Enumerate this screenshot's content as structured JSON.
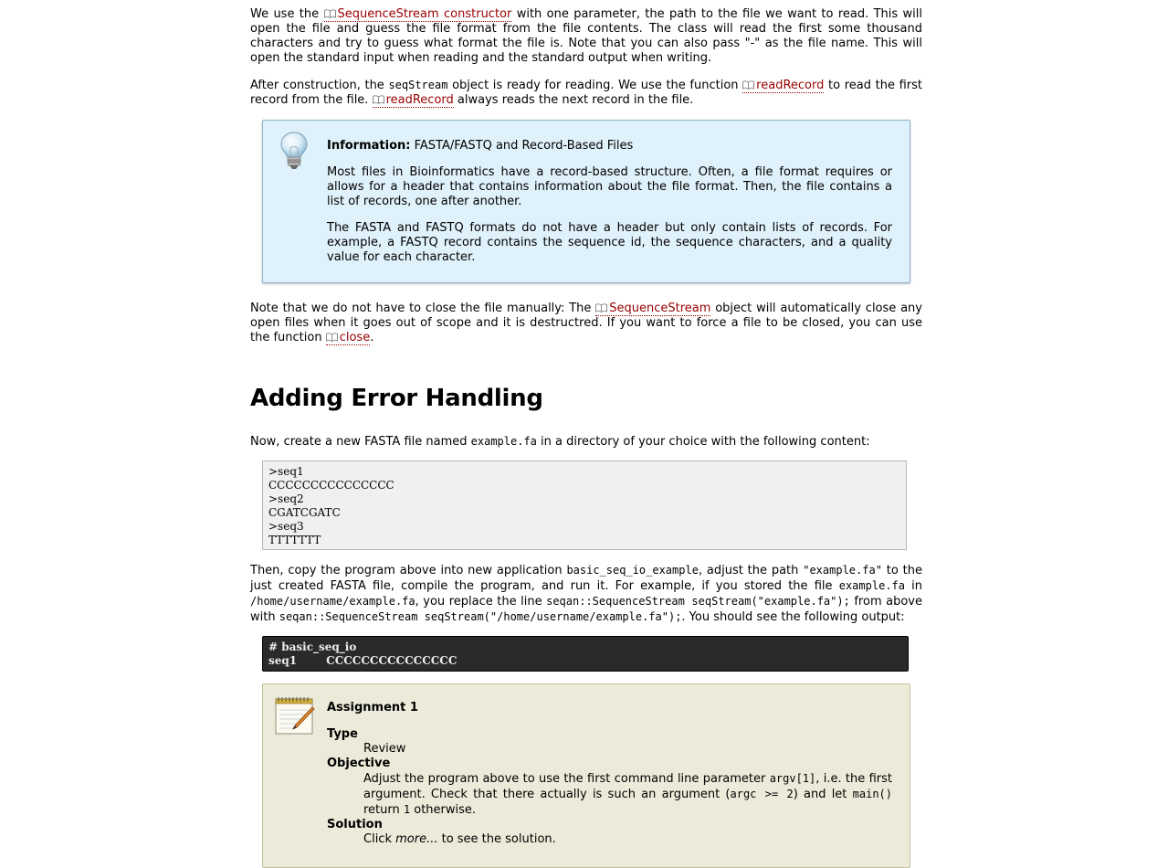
{
  "intro": {
    "p1_a": "We use the ",
    "p1_link": "SequenceStream constructor",
    "p1_b": " with one parameter, the path to the file we want to read. This will open the file and guess the file format from the file contents. The class will read the first some thousand characters and try to guess what format the file is. Note that you can also pass \"-\" as the file name. This will open the standard input when reading and the standard output when writing.",
    "p2_a": "After construction, the ",
    "p2_code": "seqStream",
    "p2_b": " object is ready for reading. We use the function ",
    "p2_link1": "readRecord",
    "p2_c": " to read the first record from the file. ",
    "p2_link2": "readRecord",
    "p2_d": " always reads the next record in the file."
  },
  "info_box": {
    "title_bold": "Information:",
    "title_rest": " FASTA/FASTQ and Record-Based Files",
    "para1": "Most files in Bioinformatics have a record-based structure. Often, a file format requires or allows for a header that contains information about the file format. Then, the file contains a list of records, one after another.",
    "para2": "The FASTA and FASTQ formats do not have a header but only contain lists of records. For example, a FASTQ record contains the sequence id, the sequence characters, and a quality value for each character."
  },
  "close_para": {
    "a": "Note that we do not have to close the file manually: The ",
    "link1": "SequenceStream",
    "b": " object will automatically close any open files when it goes out of scope and it is destructred. If you want to force a file to be closed, you can use the function ",
    "link2": "close",
    "c": "."
  },
  "section": {
    "heading": "Adding Error Handling",
    "p1_a": "Now, create a new FASTA file named ",
    "p1_code": "example.fa",
    "p1_b": " in a directory of your choice with the following content:",
    "fasta_lines": [
      ">seq1",
      "CCCCCCCCCCCCCCC",
      ">seq2",
      "CGATCGATC",
      ">seq3",
      "TTTTTTT"
    ],
    "p2_a": "Then, copy the program above into new application ",
    "p2_code1": "basic_seq_io_example",
    "p2_b": ", adjust the path ",
    "p2_code2": "\"example.fa\"",
    "p2_c": " to the just created FASTA file, compile the program, and run it. For example, if you stored the file ",
    "p2_code3": "example.fa",
    "p2_d": " in ",
    "p2_code4": "/home/username/example.fa",
    "p2_e": ", you replace the line ",
    "p2_code5": "seqan::SequenceStream seqStream(\"example.fa\");",
    "p2_f": " from above with ",
    "p2_code6": "seqan::SequenceStream seqStream(\"/home/username/example.fa\");",
    "p2_g": ". You should see the following output:",
    "output_cmd": "# basic_seq_io",
    "output_id": "seq1",
    "output_seq": "CCCCCCCCCCCCCCC"
  },
  "assignment": {
    "title": "Assignment 1",
    "type_label": "Type",
    "type_value": "Review",
    "objective_label": "Objective",
    "obj_a": "Adjust the program above to use the first command line parameter ",
    "obj_code1": "argv[1]",
    "obj_b": ", i.e. the first argument. Check that there actually is such an argument (",
    "obj_code2": "argc >= 2",
    "obj_c": ") and let ",
    "obj_code3": "main()",
    "obj_d": " return ",
    "obj_code4": "1",
    "obj_e": " otherwise.",
    "solution_label": "Solution",
    "sol_a": "Click ",
    "sol_em": "more...",
    "sol_b": " to see the solution."
  }
}
